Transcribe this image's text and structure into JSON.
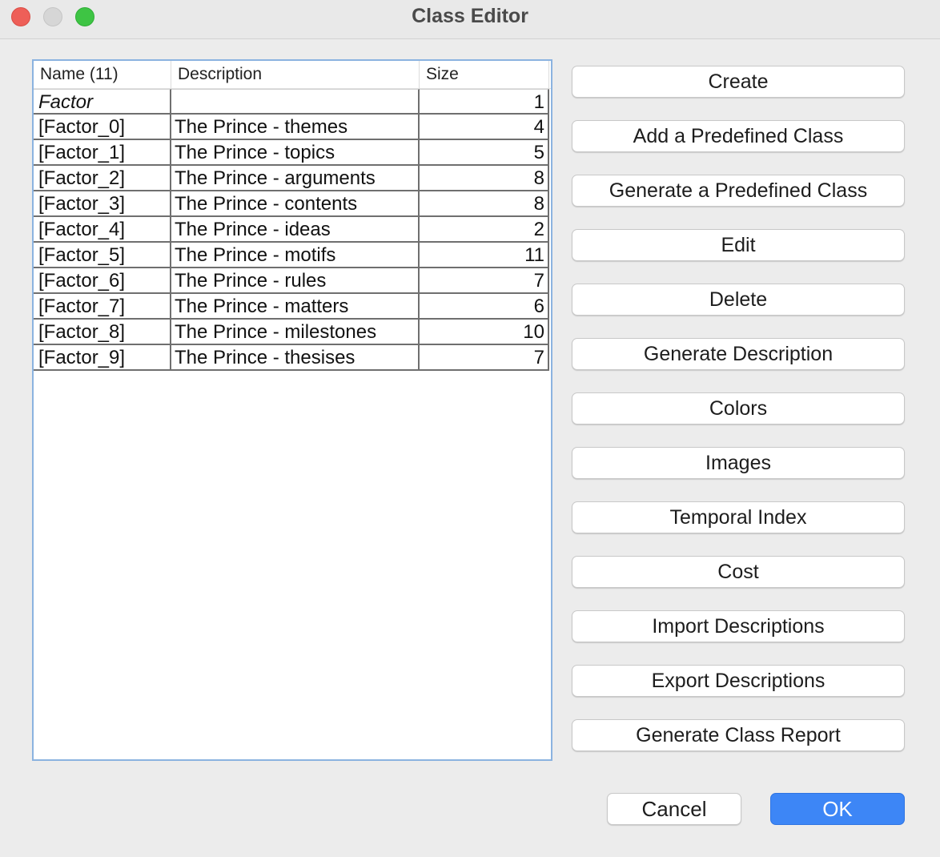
{
  "window": {
    "title": "Class Editor"
  },
  "table": {
    "headers": [
      "Name (11)",
      "Description",
      "Size"
    ],
    "rows": [
      {
        "name": "Factor",
        "description": "",
        "size": "1"
      },
      {
        "name": "[Factor_0]",
        "description": "The Prince - themes",
        "size": "4"
      },
      {
        "name": "[Factor_1]",
        "description": "The Prince - topics",
        "size": "5"
      },
      {
        "name": "[Factor_2]",
        "description": "The Prince - arguments",
        "size": "8"
      },
      {
        "name": "[Factor_3]",
        "description": "The Prince - contents",
        "size": "8"
      },
      {
        "name": "[Factor_4]",
        "description": "The Prince - ideas",
        "size": "2"
      },
      {
        "name": "[Factor_5]",
        "description": "The Prince - motifs",
        "size": "11"
      },
      {
        "name": "[Factor_6]",
        "description": "The Prince - rules",
        "size": "7"
      },
      {
        "name": "[Factor_7]",
        "description": "The Prince - matters",
        "size": "6"
      },
      {
        "name": "[Factor_8]",
        "description": "The Prince - milestones",
        "size": "10"
      },
      {
        "name": "[Factor_9]",
        "description": "The Prince - thesises",
        "size": "7"
      }
    ]
  },
  "buttons": {
    "create": "Create",
    "add_predefined": "Add a Predefined Class",
    "generate_predefined": "Generate a Predefined Class",
    "edit": "Edit",
    "delete": "Delete",
    "generate_description": "Generate Description",
    "colors": "Colors",
    "images": "Images",
    "temporal_index": "Temporal Index",
    "cost": "Cost",
    "import_descriptions": "Import Descriptions",
    "export_descriptions": "Export Descriptions",
    "generate_class_report": "Generate Class Report",
    "cancel": "Cancel",
    "ok": "OK"
  },
  "colors": {
    "accent": "#3d86f6",
    "table_border": "#8bb3e0"
  }
}
